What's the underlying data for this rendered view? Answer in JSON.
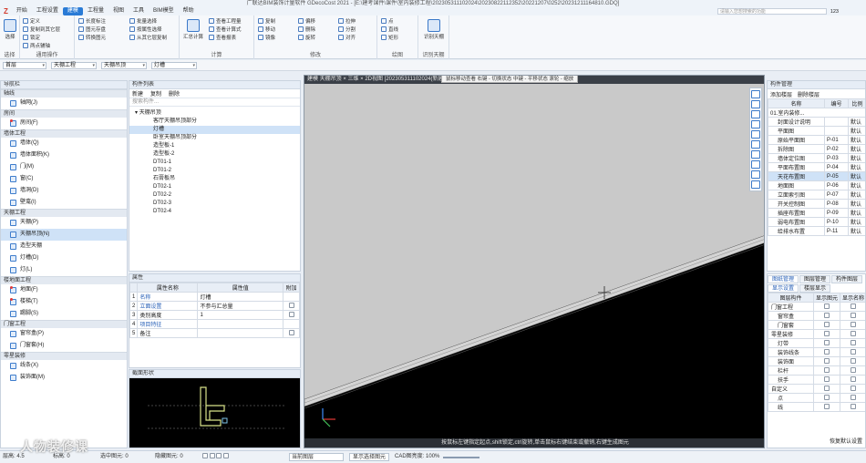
{
  "window": {
    "title": "广联达BIM装饰计量软件 GDecoCost 2021 - [E:\\建考课件\\课件\\室内装修工程\\202305311102024\\20230822112352\\20221207\\0252\\20231211164810.GDQ]"
  },
  "menu": [
    "开始",
    "工程设置",
    "建模",
    "工程量",
    "视图",
    "工具",
    "BIM模型",
    "帮助"
  ],
  "menu_active": 2,
  "search_placeholder": "请输入您想搜索的功能",
  "user_badge": "123",
  "ribbon": {
    "select": {
      "label": "选择",
      "btn": "选择"
    },
    "general": {
      "label": "通用操作",
      "items": [
        "定义",
        "复制到其它层",
        "锁定",
        "两点辅轴",
        "长度标注",
        "图元存盘",
        "转换图元",
        "批量选择",
        "按属性选择",
        "从其它层复制"
      ]
    },
    "modify": {
      "label": "修改",
      "items": [
        "修改",
        "复制",
        "移动",
        "镜像",
        "偏移",
        "删除",
        "旋转",
        "拉伸",
        "延伸",
        "修剪",
        "打断",
        "合并",
        "分割",
        "对齐",
        "设置夹点"
      ]
    },
    "calc": {
      "label": "计算",
      "items": [
        "汇总计算",
        "查看工程量",
        "查看计算式",
        "查看报表"
      ]
    },
    "draw": {
      "label": "绘图",
      "items": [
        "点",
        "直线",
        "矩形",
        "智能布置",
        "按墙布置吊顶"
      ]
    },
    "recognize": {
      "label": "识别天棚",
      "btn": "识别天棚"
    }
  },
  "selectors": [
    "首层",
    "天棚工程",
    "天棚吊顶",
    "灯槽"
  ],
  "nav": {
    "header": "导航栏",
    "sections": [
      {
        "title": "轴线",
        "items": [
          {
            "label": "轴网(J)",
            "dot": false,
            "active": false
          }
        ]
      },
      {
        "title": "房间",
        "items": [
          {
            "label": "房间(F)",
            "dot": true,
            "active": false
          }
        ]
      },
      {
        "title": "墙体工程",
        "items": [
          {
            "label": "墙体(Q)",
            "dot": false,
            "active": false
          },
          {
            "label": "墙体面积(K)",
            "dot": false,
            "active": false
          },
          {
            "label": "门(M)",
            "dot": false,
            "active": false
          },
          {
            "label": "窗(C)",
            "dot": false,
            "active": false
          },
          {
            "label": "墙洞(D)",
            "dot": false,
            "active": false
          },
          {
            "label": "壁龛(I)",
            "dot": false,
            "active": false
          }
        ]
      },
      {
        "title": "天棚工程",
        "items": [
          {
            "label": "天棚(P)",
            "dot": false,
            "active": false
          },
          {
            "label": "天棚吊顶(N)",
            "dot": false,
            "active": true
          },
          {
            "label": "造型天棚",
            "dot": false,
            "active": false
          },
          {
            "label": "灯槽(D)",
            "dot": false,
            "active": false
          },
          {
            "label": "灯(L)",
            "dot": false,
            "active": false
          }
        ]
      },
      {
        "title": "楼地面工程",
        "items": [
          {
            "label": "地面(F)",
            "dot": true,
            "active": false
          },
          {
            "label": "楼梯(T)",
            "dot": true,
            "active": false
          },
          {
            "label": "踢脚(S)",
            "dot": false,
            "active": false
          }
        ]
      },
      {
        "title": "门窗工程",
        "items": [
          {
            "label": "窗帘盒(P)",
            "dot": false,
            "active": false
          },
          {
            "label": "门窗套(H)",
            "dot": false,
            "active": false
          }
        ]
      },
      {
        "title": "零星装修",
        "items": [
          {
            "label": "线条(X)",
            "dot": false,
            "active": false
          },
          {
            "label": "装饰面(M)",
            "dot": false,
            "active": false
          }
        ]
      }
    ]
  },
  "components": {
    "header": "构件列表",
    "toolbar": [
      "新建",
      "复制",
      "删除"
    ],
    "search_placeholder": "搜索构件...",
    "root": "天棚吊顶",
    "items": [
      "客厅天棚吊顶部分",
      "灯槽",
      "卧室天棚吊顶部分",
      "造型板-1",
      "造型板-2",
      "DT01-1",
      "DT01-2",
      "石膏板吊",
      "DT02-1",
      "DT02-2",
      "DT02-3",
      "DT02-4"
    ],
    "active_index": 1
  },
  "props": {
    "header": "属性",
    "cols": [
      "属性名称",
      "属性值",
      "附加"
    ],
    "rows": [
      {
        "no": "1",
        "name": "名称",
        "value": "灯槽",
        "check": false,
        "blue": true
      },
      {
        "no": "2",
        "name": "立面设置",
        "value": "不参与汇总量",
        "check": true,
        "blue": true
      },
      {
        "no": "3",
        "name": "类别高度",
        "value": "1",
        "check": true,
        "blue": false
      },
      {
        "no": "4",
        "name": "项目特征",
        "value": "",
        "check": false,
        "blue": true
      },
      {
        "no": "5",
        "name": "备注",
        "value": "",
        "check": true,
        "blue": false
      }
    ]
  },
  "cross_section": {
    "header": "截面形状"
  },
  "viewport": {
    "tab": "建模 天棚吊顶 × 三维 × 2D视图 [202305311102024(新建)] × 平面图",
    "tooltip": "鼠标移动查看  右键 - 切换状态  中键 - 平移状态  滚轮 - 缩放",
    "status": "按鼠标左键指定起点,shift锁定,ctrl旋转,单击鼠标右键结束或撤销,右键生成图元"
  },
  "right_panel": {
    "header": "构件管理",
    "toolbar": [
      "添加楼层",
      "删除楼层"
    ],
    "cols": [
      "名称",
      "编号",
      "比例"
    ],
    "root": "01.室内装修...",
    "rows": [
      {
        "name": "封面设计说明",
        "code": "",
        "ratio": "默认"
      },
      {
        "name": "平面图",
        "code": "",
        "ratio": "默认"
      },
      {
        "name": "原始平面图",
        "code": "P-01",
        "ratio": "默认"
      },
      {
        "name": "拆除图",
        "code": "P-02",
        "ratio": "默认"
      },
      {
        "name": "墙体定位图",
        "code": "P-03",
        "ratio": "默认"
      },
      {
        "name": "平面布置图",
        "code": "P-04",
        "ratio": "默认"
      },
      {
        "name": "天花布置图",
        "code": "P-05",
        "ratio": "默认"
      },
      {
        "name": "地面图",
        "code": "P-06",
        "ratio": "默认"
      },
      {
        "name": "立面索引图",
        "code": "P-07",
        "ratio": "默认"
      },
      {
        "name": "开关控制图",
        "code": "P-08",
        "ratio": "默认"
      },
      {
        "name": "插座布置图",
        "code": "P-09",
        "ratio": "默认"
      },
      {
        "name": "弱电布置图",
        "code": "P-10",
        "ratio": "默认"
      },
      {
        "name": "给排水布置",
        "code": "P-11",
        "ratio": "默认"
      }
    ],
    "active_row": 6,
    "tabs": [
      "图纸管理",
      "图层管理",
      "构件图层"
    ],
    "subtabs": [
      "显示设置",
      "楼层显示"
    ],
    "display_cols": [
      "图层构件",
      "显示图元",
      "显示名称"
    ],
    "display_rows": [
      {
        "name": "门窗工程",
        "group": true
      },
      {
        "name": "窗帘盒",
        "group": false
      },
      {
        "name": "门窗套",
        "group": false
      },
      {
        "name": "零星装修",
        "group": true
      },
      {
        "name": "灯带",
        "group": false
      },
      {
        "name": "装饰线条",
        "group": false
      },
      {
        "name": "装饰面",
        "group": false
      },
      {
        "name": "栏杆",
        "group": false
      },
      {
        "name": "扶手",
        "group": false
      },
      {
        "name": "自定义",
        "group": true
      },
      {
        "name": "点",
        "group": false
      },
      {
        "name": "线",
        "group": false
      }
    ],
    "restore": "恢复默认设置"
  },
  "statusbar": {
    "scale": "层高: 4.5",
    "elevation": "标高: 0",
    "floor": "选中图元: 0",
    "hidden": "隐藏图元: 0",
    "layer": "当前图层",
    "cad_label": "显示选择图元",
    "cad_bright": "CAD图亮度: 100%"
  },
  "watermark": "人物装修课"
}
